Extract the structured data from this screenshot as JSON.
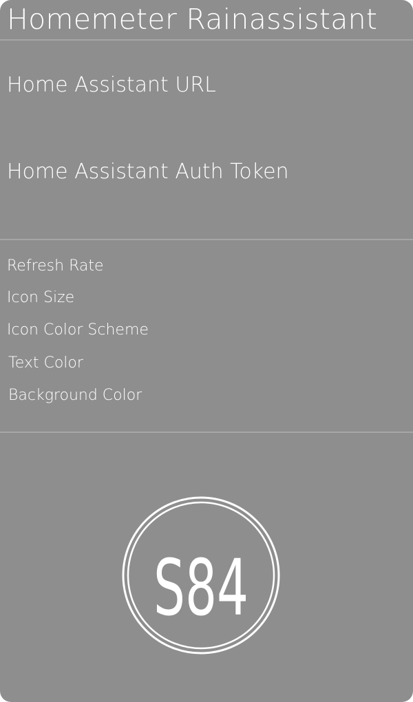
{
  "app": {
    "title": "Homemeter Rainassistant"
  },
  "connection": {
    "url_label": "Home Assistant URL",
    "token_label": "Home Assistant Auth Token"
  },
  "display": {
    "items": [
      {
        "label": "Refresh Rate"
      },
      {
        "label": "Icon Size"
      },
      {
        "label": "Icon Color Scheme"
      },
      {
        "label": "Text Color"
      },
      {
        "label": "Background Color"
      }
    ]
  },
  "logo": {
    "text": "S84",
    "icon": "s84-logo-icon"
  },
  "colors": {
    "background": "#8e8e8e",
    "text": "#ffffff",
    "divider": "#a6a6a6"
  }
}
